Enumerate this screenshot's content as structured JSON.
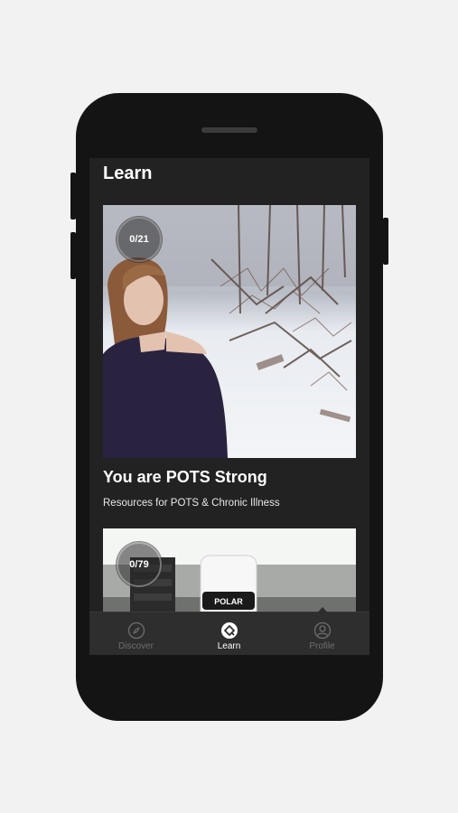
{
  "header": {
    "title": "Learn"
  },
  "cards": [
    {
      "title": "You are POTS Strong",
      "subtitle": "Resources for POTS & Chronic Illness",
      "progress_text": "0/21",
      "progress_fraction": 0.0
    },
    {
      "progress_text": "0/79",
      "progress_fraction": 0.0,
      "device_label": "POLAR"
    }
  ],
  "tabbar": {
    "tabs": [
      {
        "label": "Discover",
        "icon": "compass-icon",
        "active": false
      },
      {
        "label": "Learn",
        "icon": "learn-icon",
        "active": true
      },
      {
        "label": "Profile",
        "icon": "profile-icon",
        "active": false
      }
    ]
  },
  "colors": {
    "screen_bg": "#222222",
    "tabbar_bg": "#2e2e2e",
    "tab_active": "#ffffff",
    "tab_inactive": "#6e6e6e"
  }
}
